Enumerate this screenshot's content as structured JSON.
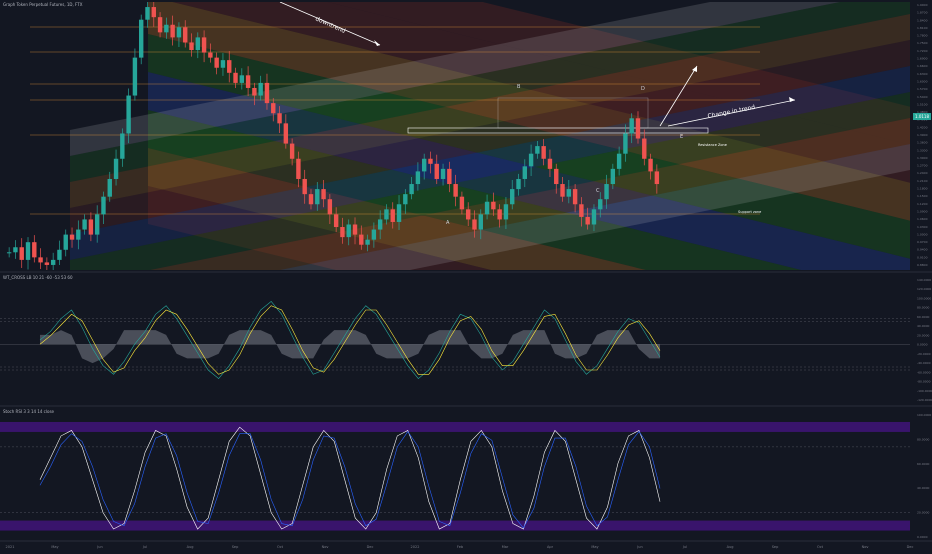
{
  "header": {
    "symbol_title": "Graph Token Perpetual Futures, 1D, FTX",
    "osc_title": "WT_CROSS LB 10 21 -60 -53 53 60",
    "stoch_title": "Stoch RSI 3 3 14 14 close"
  },
  "colors": {
    "background": "#131722",
    "up_candle": "#26a69a",
    "down_candle": "#ef5350",
    "channel_blue": "#1e3a8a",
    "channel_green": "#1b5e20",
    "channel_orange": "#8d5a22",
    "channel_red": "#5d2323",
    "channel_white": "#d1d4dc",
    "purple_band": "#4a148c",
    "price_badge": "#26a69a",
    "fib_line": "#f7a13b",
    "annotation": "#ffffff"
  },
  "chart_data": [
    {
      "type": "candlestick",
      "title": "Graph Token Perpetual Futures, 1D, FTX",
      "y_axis_side": "right",
      "y_ticks": [
        "1.9000",
        "1.8700",
        "1.8400",
        "1.8100",
        "1.7800",
        "1.7500",
        "1.7200",
        "1.6900",
        "1.6600",
        "1.6300",
        "1.6000",
        "1.5700",
        "1.5400",
        "1.5100",
        "1.4800",
        "1.4500",
        "1.4200",
        "1.3900",
        "1.3600",
        "1.3300",
        "1.3000",
        "1.2700",
        "1.2400",
        "1.2100",
        "1.1800",
        "1.1500",
        "1.1200",
        "1.0900",
        "1.0600",
        "1.0300",
        "1.0000",
        "0.9700",
        "0.9400",
        "0.9100",
        "0.8800"
      ],
      "ylim": [
        0.86,
        1.92
      ],
      "current_price": "1.0118",
      "candle_close_path": [
        0.93,
        0.95,
        0.9,
        0.97,
        0.91,
        0.89,
        0.88,
        0.9,
        0.94,
        1.0,
        0.98,
        1.02,
        1.06,
        1.0,
        1.08,
        1.15,
        1.22,
        1.3,
        1.4,
        1.55,
        1.7,
        1.85,
        1.9,
        1.86,
        1.8,
        1.83,
        1.78,
        1.82,
        1.76,
        1.73,
        1.78,
        1.72,
        1.7,
        1.66,
        1.69,
        1.64,
        1.6,
        1.63,
        1.58,
        1.55,
        1.6,
        1.52,
        1.48,
        1.44,
        1.36,
        1.3,
        1.22,
        1.16,
        1.12,
        1.18,
        1.14,
        1.08,
        1.03,
        0.99,
        1.04,
        1.0,
        0.96,
        0.98,
        1.02,
        1.06,
        1.1,
        1.05,
        1.12,
        1.16,
        1.2,
        1.25,
        1.3,
        1.28,
        1.22,
        1.26,
        1.2,
        1.15,
        1.1,
        1.06,
        1.02,
        1.08,
        1.13,
        1.1,
        1.06,
        1.12,
        1.18,
        1.22,
        1.27,
        1.32,
        1.35,
        1.3,
        1.26,
        1.2,
        1.15,
        1.18,
        1.12,
        1.07,
        1.04,
        1.1,
        1.14,
        1.2,
        1.26,
        1.32,
        1.4,
        1.46,
        1.38,
        1.3,
        1.25,
        1.2
      ],
      "trendline_labels": [
        "downtrend",
        "Change in trend"
      ],
      "annotations": [
        "A",
        "B",
        "C",
        "D",
        "E"
      ],
      "level_labels": [
        "Support zone",
        "Resistance Zone"
      ]
    },
    {
      "type": "line",
      "title": "WT_CROSS LB 10 21 -60 -53 53 60",
      "y_ticks": [
        "140.0000",
        "120.0000",
        "100.0000",
        "80.0000",
        "60.0000",
        "40.0000",
        "20.0000",
        "0.0000",
        "-20.0000",
        "-40.0000",
        "-60.0000",
        "-80.0000",
        "-100.0000",
        "-120.0000"
      ],
      "ylim": [
        -130,
        150
      ],
      "reference_levels": [
        60,
        53,
        0,
        -53,
        -60
      ],
      "series": [
        {
          "values": [
            10,
            30,
            60,
            80,
            40,
            -10,
            -50,
            -70,
            -40,
            0,
            30,
            70,
            90,
            60,
            20,
            -20,
            -60,
            -80,
            -50,
            -10,
            40,
            80,
            100,
            70,
            20,
            -30,
            -70,
            -60,
            -20,
            20,
            60,
            90,
            70,
            30,
            -10,
            -50,
            -80,
            -60,
            -20,
            30,
            70,
            60,
            20,
            -30,
            -60,
            -40,
            0,
            40,
            80,
            60,
            10,
            -40,
            -70,
            -50,
            -10,
            30,
            60,
            50,
            10,
            -30
          ]
        },
        {
          "values": [
            0,
            20,
            45,
            70,
            55,
            10,
            -35,
            -65,
            -55,
            -15,
            15,
            55,
            80,
            70,
            35,
            -5,
            -45,
            -70,
            -60,
            -25,
            25,
            65,
            90,
            80,
            35,
            -15,
            -55,
            -65,
            -35,
            5,
            45,
            80,
            80,
            45,
            5,
            -35,
            -70,
            -70,
            -35,
            15,
            55,
            65,
            35,
            -15,
            -50,
            -50,
            -15,
            25,
            65,
            70,
            25,
            -25,
            -60,
            -60,
            -25,
            15,
            45,
            55,
            25,
            -15
          ]
        }
      ]
    },
    {
      "type": "line",
      "title": "Stoch RSI 3 3 14 14 close",
      "y_ticks": [
        "100.0000",
        "80.0000",
        "60.0000",
        "40.0000",
        "20.0000",
        "0.0000"
      ],
      "ylim": [
        -5,
        110
      ],
      "reference_levels": [
        80,
        20
      ],
      "series": [
        {
          "values": [
            50,
            70,
            90,
            95,
            80,
            50,
            20,
            5,
            10,
            40,
            75,
            95,
            90,
            60,
            25,
            5,
            15,
            50,
            85,
            98,
            90,
            55,
            20,
            5,
            10,
            45,
            80,
            95,
            85,
            50,
            15,
            5,
            20,
            60,
            90,
            95,
            70,
            30,
            5,
            10,
            50,
            85,
            95,
            80,
            40,
            10,
            5,
            35,
            75,
            95,
            85,
            50,
            15,
            5,
            25,
            65,
            90,
            95,
            70,
            30
          ]
        },
        {
          "values": [
            45,
            62,
            82,
            92,
            85,
            62,
            32,
            12,
            8,
            28,
            62,
            88,
            92,
            72,
            38,
            12,
            10,
            38,
            72,
            92,
            92,
            68,
            32,
            10,
            8,
            32,
            68,
            90,
            88,
            62,
            28,
            8,
            14,
            46,
            80,
            94,
            80,
            44,
            12,
            8,
            38,
            74,
            92,
            86,
            52,
            18,
            6,
            24,
            62,
            88,
            88,
            62,
            26,
            8,
            16,
            50,
            82,
            94,
            80,
            42
          ]
        }
      ]
    }
  ],
  "x_axis": {
    "labels": [
      "2021",
      "May",
      "Jun",
      "Jul",
      "Aug",
      "Sep",
      "Oct",
      "Nov",
      "Dec",
      "2022",
      "Feb",
      "Mar",
      "Apr",
      "May",
      "Jun",
      "Jul",
      "Aug",
      "Sep",
      "Oct",
      "Nov",
      "Dec"
    ],
    "year_label": "2021"
  }
}
